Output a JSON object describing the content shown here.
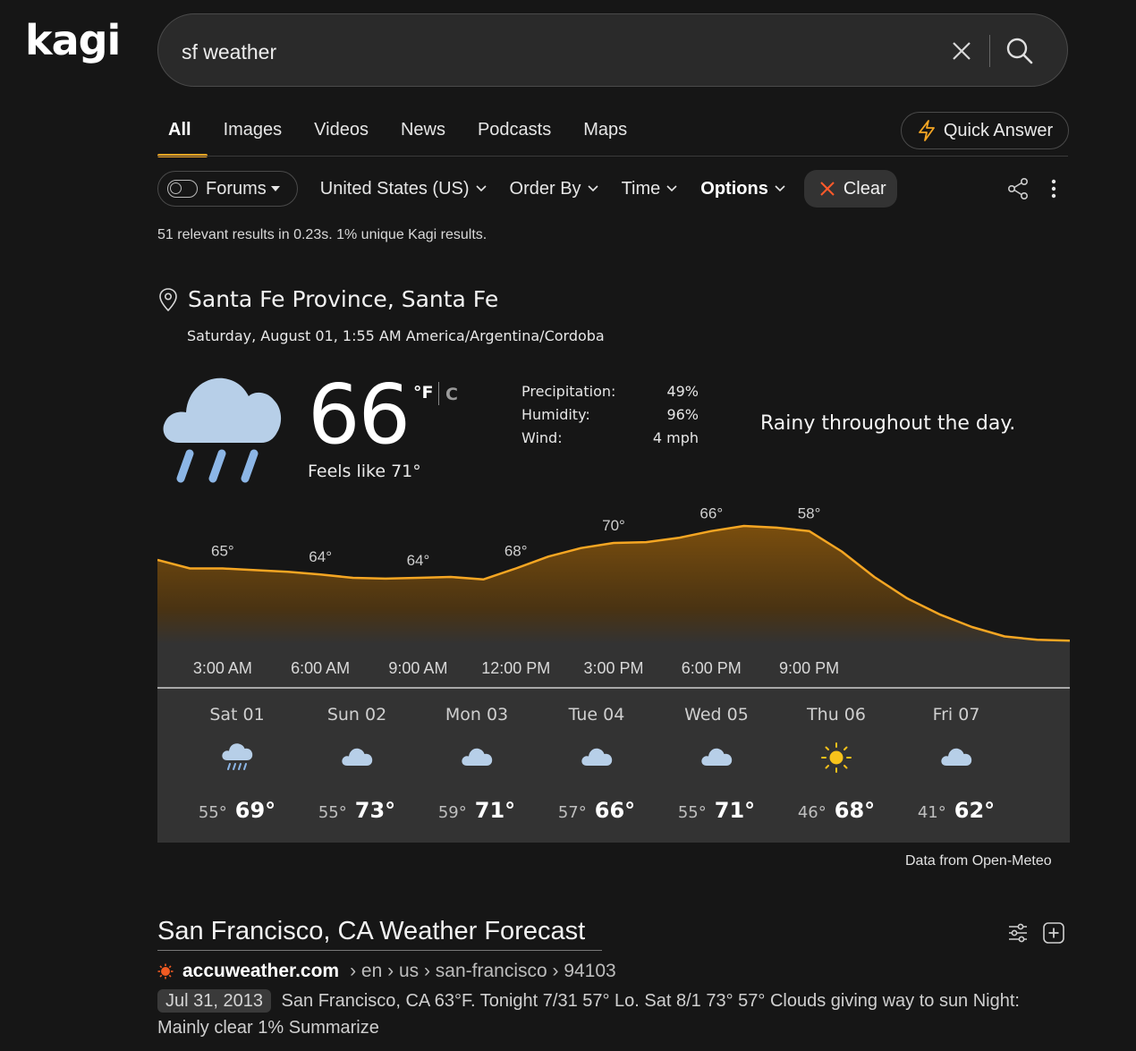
{
  "brand": {
    "logo_text": "kagi"
  },
  "search": {
    "query": "sf weather",
    "clear_icon": "close-icon",
    "submit_icon": "search-icon"
  },
  "tabs": [
    {
      "label": "All",
      "active": true
    },
    {
      "label": "Images"
    },
    {
      "label": "Videos"
    },
    {
      "label": "News"
    },
    {
      "label": "Podcasts"
    },
    {
      "label": "Maps"
    }
  ],
  "quick_answer": {
    "label": "Quick Answer",
    "icon": "lightning-icon"
  },
  "filters": {
    "forums": "Forums",
    "region": "United States (US)",
    "order_by": "Order By",
    "time": "Time",
    "options": "Options",
    "clear": "Clear"
  },
  "stats": "51 relevant results in 0.23s. 1% unique Kagi results.",
  "weather": {
    "location": "Santa Fe Province, Santa Fe",
    "datetime": "Saturday, August 01, 1:55 AM America/Argentina/Cordoba",
    "temperature": "66",
    "unit_f": "°F",
    "unit_c": "C",
    "feels_like": "Feels like 71°",
    "condition_icon": "rain-cloud-icon",
    "details": [
      {
        "label": "Precipitation:",
        "value": "49%"
      },
      {
        "label": "Humidity:",
        "value": "96%"
      },
      {
        "label": "Wind:",
        "value": "4 mph"
      }
    ],
    "summary": "Rainy throughout the day.",
    "accent_color": "#f5a623",
    "hourly": {
      "temps": [
        66,
        65,
        65,
        64.8,
        64.6,
        64.3,
        63.9,
        63.8,
        63.9,
        64,
        63.7,
        65,
        66.4,
        67.4,
        68,
        68.1,
        68.6,
        69.4,
        70,
        69.8,
        69.4,
        67,
        64,
        61.5,
        59.6,
        58.1,
        57,
        56.6,
        56.5
      ],
      "labels": [
        {
          "i": 2,
          "text": "65°"
        },
        {
          "i": 5,
          "text": "64°"
        },
        {
          "i": 8,
          "text": "64°"
        },
        {
          "i": 11,
          "text": "68°"
        },
        {
          "i": 14,
          "text": "70°"
        },
        {
          "i": 17,
          "text": "66°"
        },
        {
          "i": 20,
          "text": "58°"
        }
      ],
      "time_labels": [
        "3:00 AM",
        "6:00 AM",
        "9:00 AM",
        "12:00 PM",
        "3:00 PM",
        "6:00 PM",
        "9:00 PM"
      ]
    },
    "daily": [
      {
        "day": "Sat 01",
        "icon": "rain-cloud-icon",
        "lo": "55°",
        "hi": "69°"
      },
      {
        "day": "Sun 02",
        "icon": "cloud-icon",
        "lo": "55°",
        "hi": "73°"
      },
      {
        "day": "Mon 03",
        "icon": "cloud-icon",
        "lo": "59°",
        "hi": "71°"
      },
      {
        "day": "Tue 04",
        "icon": "cloud-icon",
        "lo": "57°",
        "hi": "66°"
      },
      {
        "day": "Wed 05",
        "icon": "cloud-icon",
        "lo": "55°",
        "hi": "71°"
      },
      {
        "day": "Thu 06",
        "icon": "sun-icon",
        "lo": "46°",
        "hi": "68°"
      },
      {
        "day": "Fri 07",
        "icon": "cloud-icon",
        "lo": "41°",
        "hi": "62°"
      }
    ],
    "credit": "Data from Open-Meteo"
  },
  "result": {
    "title": "San Francisco, CA Weather Forecast",
    "domain": "accuweather.com",
    "path": "› en › us › san-francisco › 94103",
    "date": "Jul 31, 2013",
    "snippet": "San Francisco, CA 63°F. Tonight 7/31 57° Lo. Sat 8/1 73° 57° Clouds giving way to sun Night: Mainly clear 1%",
    "summarize": "Summarize"
  }
}
